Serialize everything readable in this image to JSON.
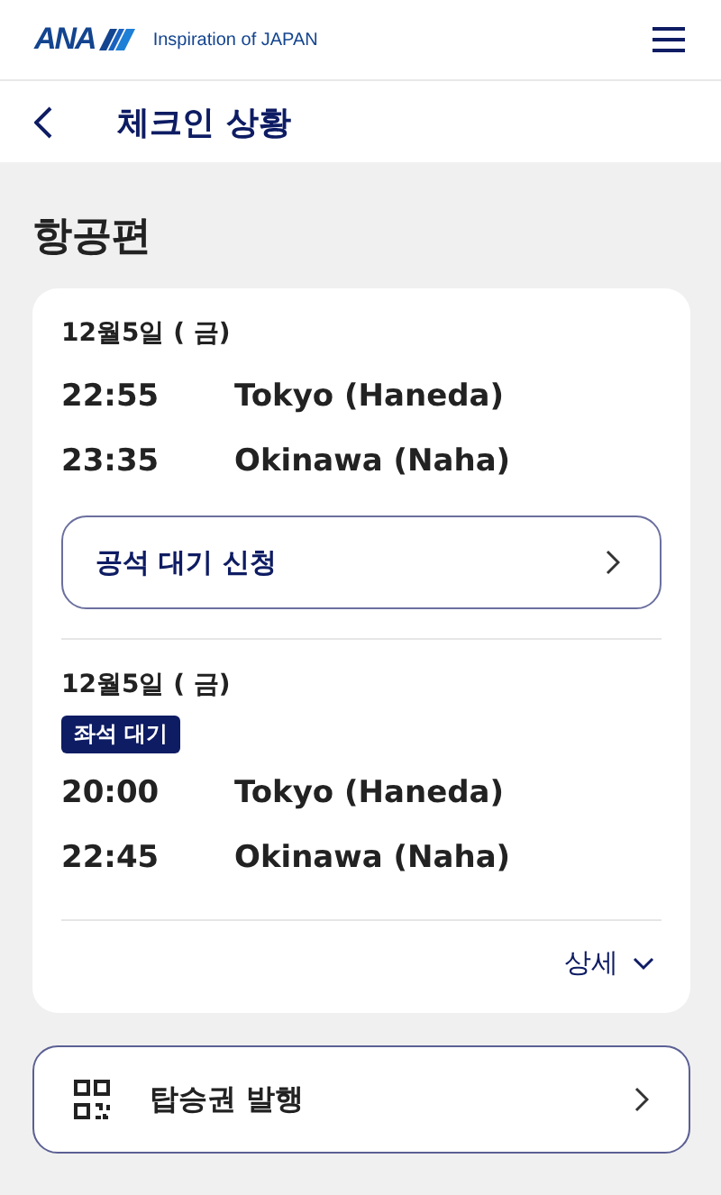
{
  "header": {
    "logo": "ANA",
    "tagline": "Inspiration of JAPAN"
  },
  "nav": {
    "title": "체크인 상황"
  },
  "section_title": "항공편",
  "flights": [
    {
      "date": "12월5일 ( 금)",
      "legs": [
        {
          "time": "22:55",
          "place": "Tokyo (Haneda)"
        },
        {
          "time": "23:35",
          "place": "Okinawa (Naha)"
        }
      ],
      "action": "공석 대기 신청"
    },
    {
      "date": "12월5일 ( 금)",
      "badge": "좌석 대기",
      "legs": [
        {
          "time": "20:00",
          "place": "Tokyo (Haneda)"
        },
        {
          "time": "22:45",
          "place": "Okinawa (Naha)"
        }
      ]
    }
  ],
  "details_link": "상세",
  "boarding_pass_button": "탑승권 발행"
}
